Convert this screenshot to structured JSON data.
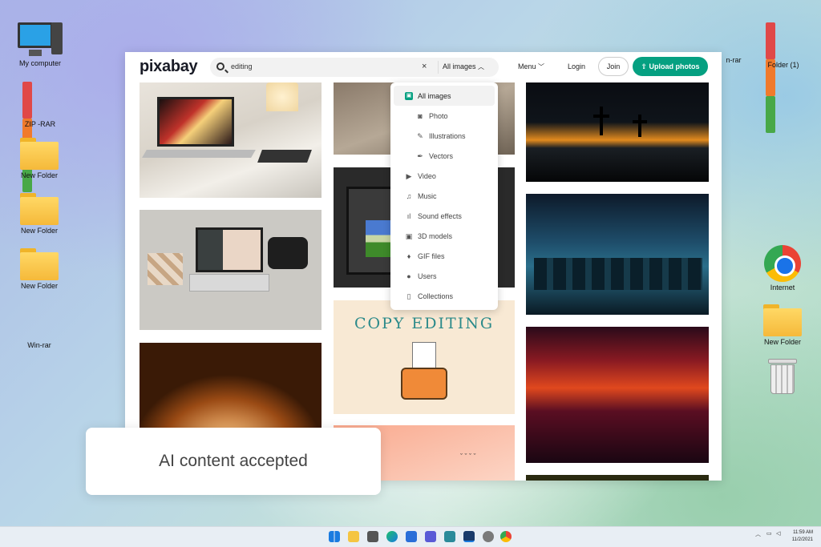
{
  "desktop": {
    "left_icons": [
      "My computer",
      "ZIP -RAR",
      "New Folder",
      "New Folder",
      "New Folder",
      "Win-rar"
    ],
    "right_top_icons": [
      "n-rar",
      "Folder (1)"
    ],
    "right_icons": [
      "Internet",
      "New Folder"
    ]
  },
  "browser": {
    "logo": "pixabay",
    "search": {
      "value": "editing",
      "clear": "×",
      "filter": "All images"
    },
    "nav": {
      "menu": "Menu",
      "login": "Login",
      "join": "Join",
      "upload": "Upload photos"
    },
    "dropdown": [
      {
        "label": "All images",
        "icon": "image-icon"
      },
      {
        "label": "Photo",
        "icon": "camera-icon"
      },
      {
        "label": "Illustrations",
        "icon": "brush-icon"
      },
      {
        "label": "Vectors",
        "icon": "pen-tool-icon"
      },
      {
        "label": "Video",
        "icon": "video-icon"
      },
      {
        "label": "Music",
        "icon": "music-icon"
      },
      {
        "label": "Sound effects",
        "icon": "sound-wave-icon"
      },
      {
        "label": "3D models",
        "icon": "cube-icon"
      },
      {
        "label": "GIF files",
        "icon": "gif-icon"
      },
      {
        "label": "Users",
        "icon": "user-icon"
      },
      {
        "label": "Collections",
        "icon": "bookmark-icon"
      }
    ],
    "copy_editing_text": "COPY EDITING"
  },
  "toast": {
    "text": "AI content accepted"
  },
  "taskbar": {
    "time": "11:59 AM",
    "date": "11/2/2021"
  },
  "colors": {
    "accent": "#05a081",
    "brand_text": "#191b26"
  }
}
